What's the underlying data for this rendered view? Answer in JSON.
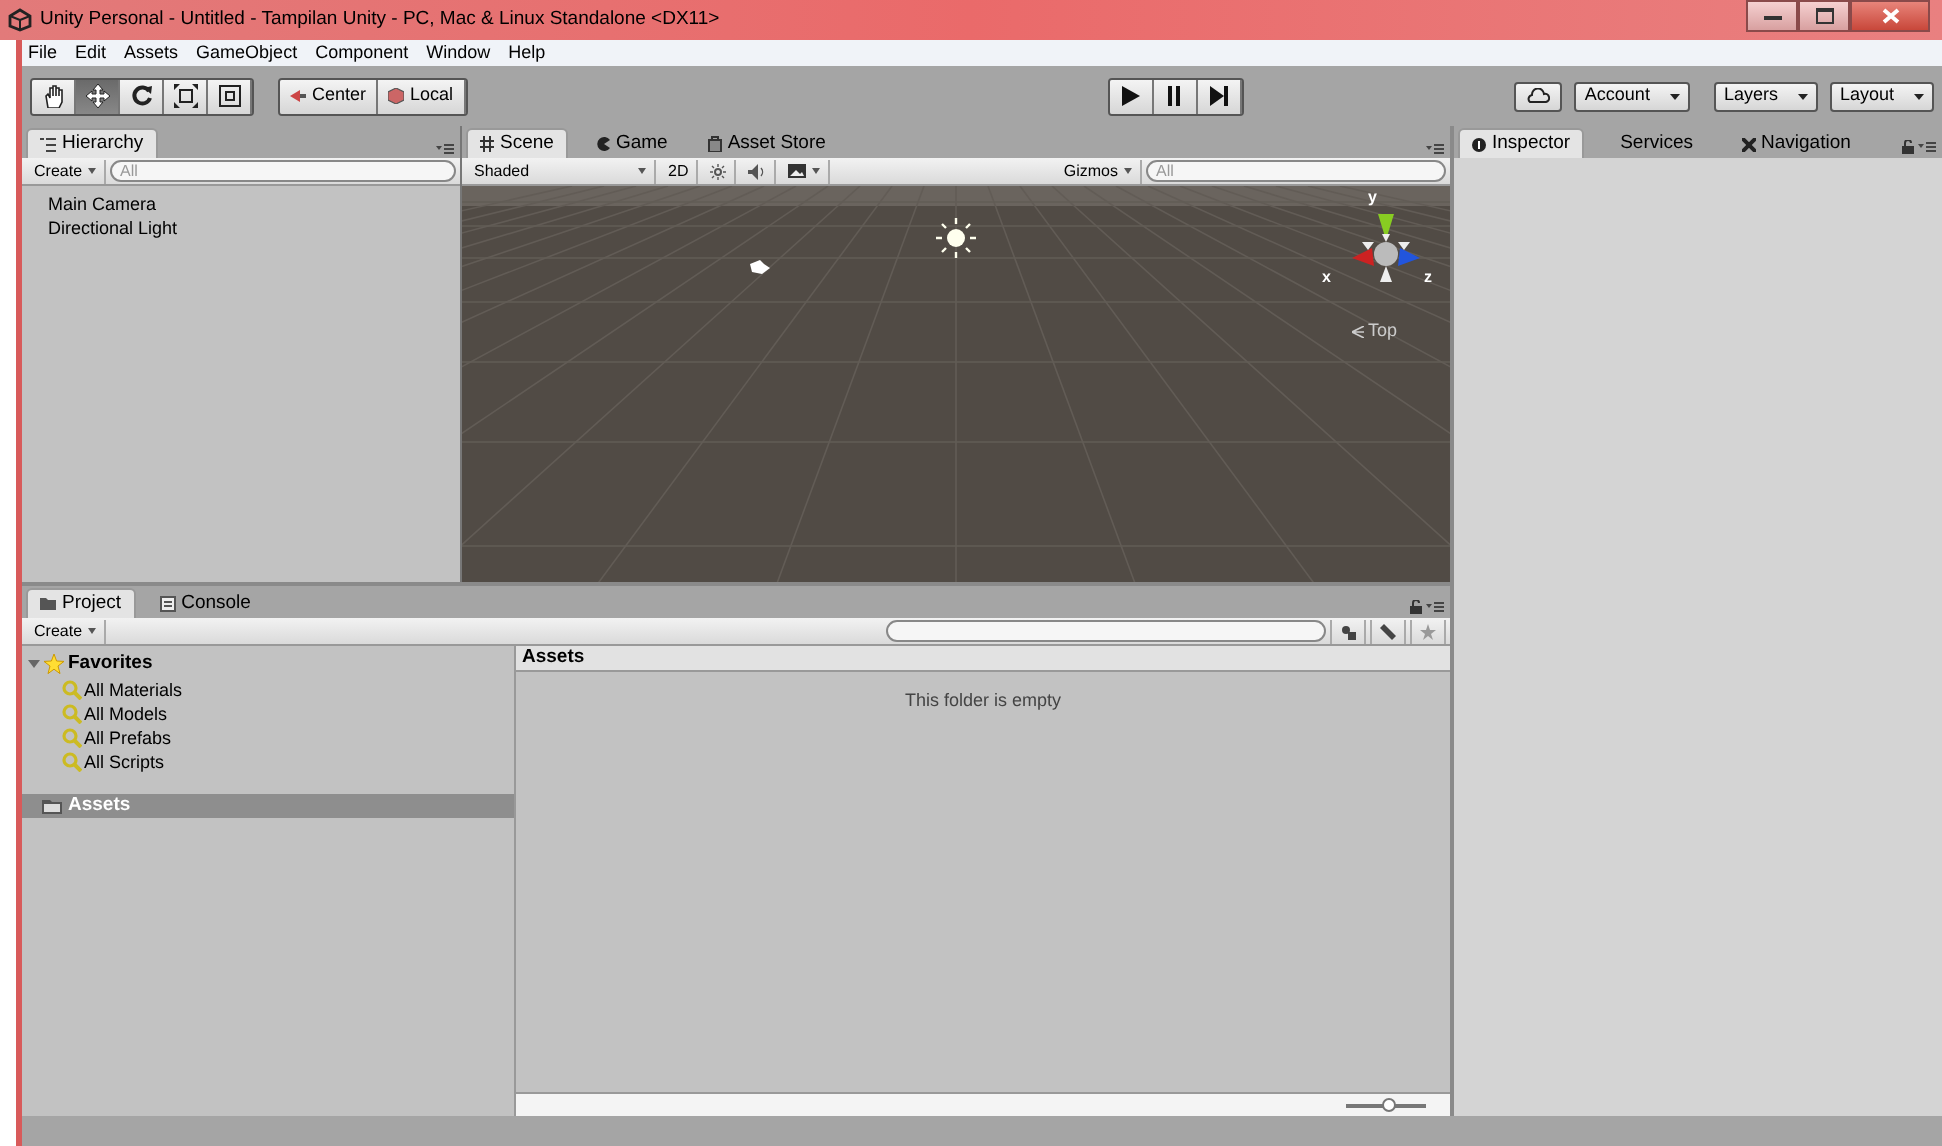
{
  "window": {
    "title": "Unity Personal - Untitled - Tampilan Unity - PC, Mac & Linux Standalone <DX11>"
  },
  "menu": [
    "File",
    "Edit",
    "Assets",
    "GameObject",
    "Component",
    "Window",
    "Help"
  ],
  "toolbar": {
    "tools": [
      {
        "kind": "hand",
        "selected": false
      },
      {
        "kind": "move",
        "selected": true
      },
      {
        "kind": "rotate",
        "selected": false
      },
      {
        "kind": "scale",
        "selected": false
      },
      {
        "kind": "rect",
        "selected": false
      }
    ],
    "pivot": [
      "Center",
      "Local"
    ],
    "dropdowns": [
      "Account",
      "Layers",
      "Layout"
    ]
  },
  "hierarchy": {
    "tab": "Hierarchy",
    "create": "Create",
    "search_placeholder": "All",
    "items": [
      "Main Camera",
      "Directional Light"
    ]
  },
  "scene": {
    "tabs": [
      {
        "label": "Scene",
        "kind": "scene",
        "selected": true
      },
      {
        "label": "Game",
        "kind": "game",
        "selected": false
      },
      {
        "label": "Asset Store",
        "kind": "store",
        "selected": false
      }
    ],
    "shading": "Shaded",
    "mode_2d": "2D",
    "lighting_on": false,
    "audio_on": false,
    "gizmos": "Gizmos",
    "search_placeholder": "All",
    "axes": [
      "y",
      "x",
      "z"
    ],
    "view_label": "Top"
  },
  "inspector": {
    "tabs": [
      {
        "label": "Inspector",
        "kind": "info",
        "selected": true
      },
      {
        "label": "Services",
        "kind": "none",
        "selected": false
      },
      {
        "label": "Navigation",
        "kind": "nav",
        "selected": false
      }
    ]
  },
  "project": {
    "tabs": [
      {
        "label": "Project",
        "kind": "folder",
        "selected": true
      },
      {
        "label": "Console",
        "kind": "console",
        "selected": false
      }
    ],
    "create": "Create",
    "favorites": {
      "label": "Favorites",
      "expanded": true,
      "children": [
        "All Materials",
        "All Models",
        "All Prefabs",
        "All Scripts"
      ]
    },
    "assets": {
      "label": "Assets",
      "selected": true
    },
    "header": "Assets",
    "empty_message": "This folder is empty",
    "zoom": {
      "level": 0.55
    }
  }
}
